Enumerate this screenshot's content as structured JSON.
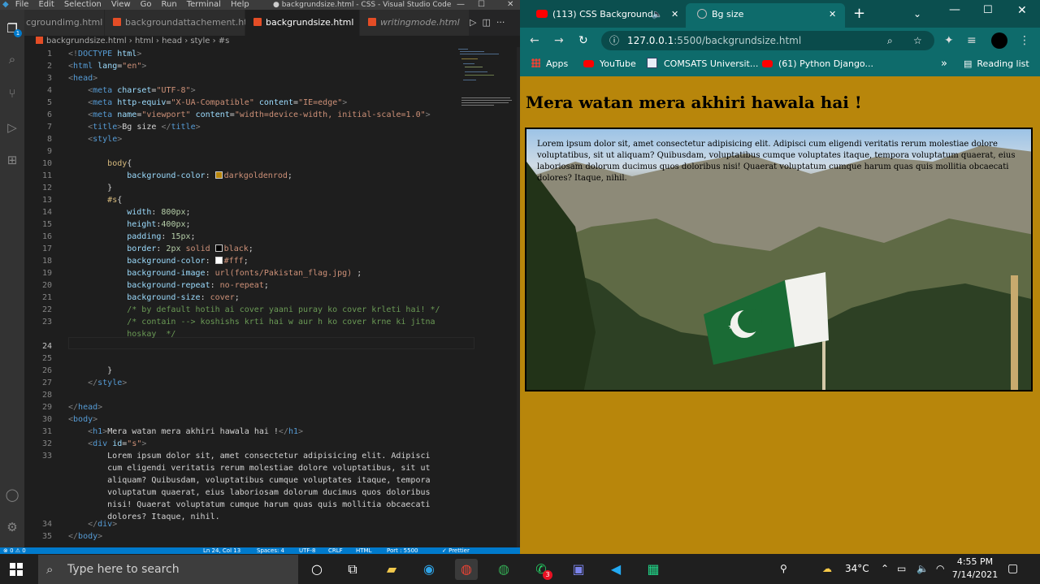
{
  "vscode": {
    "menu": [
      "File",
      "Edit",
      "Selection",
      "View",
      "Go",
      "Run",
      "Terminal",
      "Help"
    ],
    "window_title": "● backgrundsize.html - CSS - Visual Studio Code",
    "tabs": [
      {
        "label": "cgroundimg.html",
        "active": false,
        "italic": false
      },
      {
        "label": "backgroundattachement.html",
        "active": false,
        "italic": false
      },
      {
        "label": "backgrundsize.html",
        "active": true,
        "italic": false,
        "modified": true
      },
      {
        "label": "writingmode.html",
        "active": false,
        "italic": true
      }
    ],
    "breadcrumb": [
      "backgrundsize.html",
      "html",
      "head",
      "style",
      "#s"
    ],
    "source_control_badge": "1",
    "status_bar": {
      "left": "⊗ 0 ⚠ 0",
      "position": "Ln 24, Col 13",
      "spaces": "Spaces: 4",
      "encoding": "UTF-8",
      "eol": "CRLF",
      "language": "HTML",
      "port": "Port : 5500",
      "formatter": "✓ Prettier"
    }
  },
  "browser": {
    "tabs": [
      {
        "label": "(113) CSS Background"
      },
      {
        "label": "Bg size"
      }
    ],
    "url_host": "127.0.0.1",
    "url_path": ":5500/backgrundsize.html",
    "bookmarks": [
      "Apps",
      "YouTube",
      "COMSATS Universit...",
      "(61) Python Django..."
    ],
    "reading_list": "Reading list",
    "page": {
      "heading": "Mera watan mera akhiri hawala hai !",
      "text": "Lorem ipsum dolor sit, amet consectetur adipisicing elit. Adipisci cum eligendi veritatis rerum molestiae dolore voluptatibus, sit ut aliquam? Quibusdam, voluptatibus cumque voluptates itaque, tempora voluptatum quaerat, eius laboriosam dolorum ducimus quos doloribus nisi! Quaerat voluptatum cumque harum quas quis mollitia obcaecati dolores? Itaque, nihil.",
      "background_color": "#b8860b"
    }
  },
  "taskbar": {
    "search_placeholder": "Type here to search",
    "temperature": "34°C",
    "time": "4:55 PM",
    "date": "7/14/2021",
    "whatsapp_badge": "3"
  }
}
